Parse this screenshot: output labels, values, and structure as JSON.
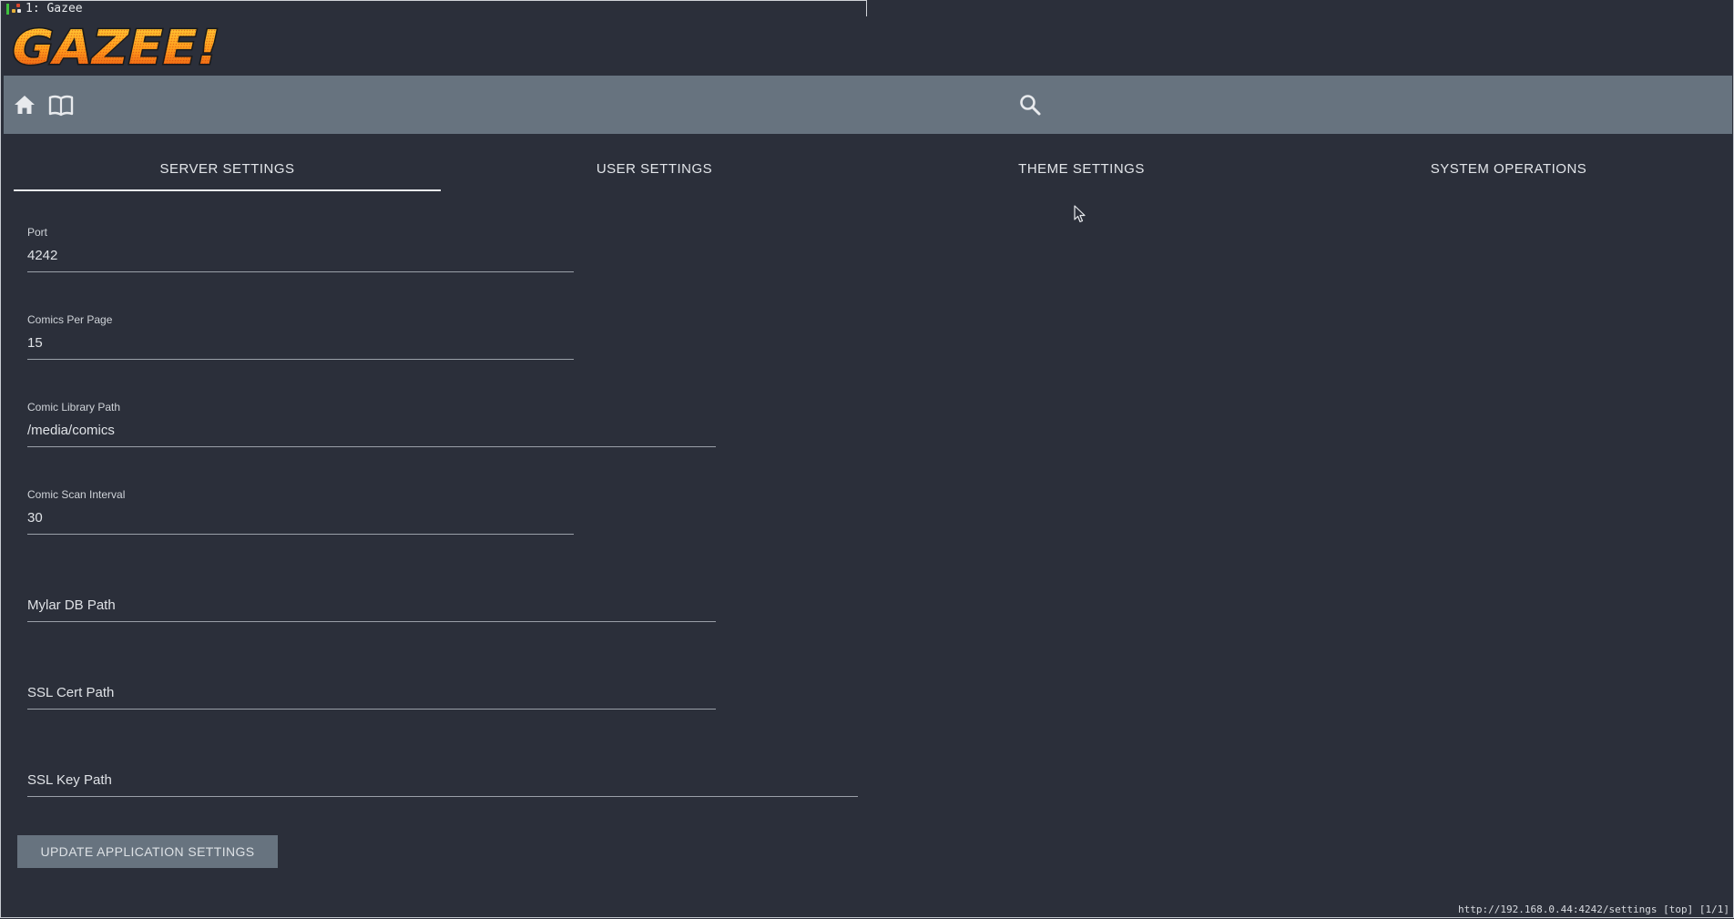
{
  "window": {
    "title": "1: Gazee"
  },
  "app": {
    "logo_text": "GAZEE!"
  },
  "navbar": {
    "home_icon": "home-icon",
    "library_icon": "book-icon",
    "search_icon": "search-icon"
  },
  "tabs": [
    {
      "label": "SERVER SETTINGS",
      "active": true
    },
    {
      "label": "USER SETTINGS",
      "active": false
    },
    {
      "label": "THEME SETTINGS",
      "active": false
    },
    {
      "label": "SYSTEM OPERATIONS",
      "active": false
    }
  ],
  "form": {
    "port": {
      "label": "Port",
      "value": "4242"
    },
    "comics_per_page": {
      "label": "Comics Per Page",
      "value": "15"
    },
    "comic_library_path": {
      "label": "Comic Library Path",
      "value": "/media/comics"
    },
    "comic_scan_interval": {
      "label": "Comic Scan Interval",
      "value": "30"
    },
    "mylar_db_path": {
      "placeholder": "Mylar DB Path",
      "value": ""
    },
    "ssl_cert_path": {
      "placeholder": "SSL Cert Path",
      "value": ""
    },
    "ssl_key_path": {
      "placeholder": "SSL Key Path",
      "value": ""
    },
    "submit_label": "UPDATE APPLICATION SETTINGS"
  },
  "status": {
    "url": "http://192.168.0.44:4242/settings [top] [1/1]"
  },
  "colors": {
    "background": "#2b2f3a",
    "navbar": "#67737f",
    "button": "#67737f",
    "text": "#d8dbe0"
  }
}
